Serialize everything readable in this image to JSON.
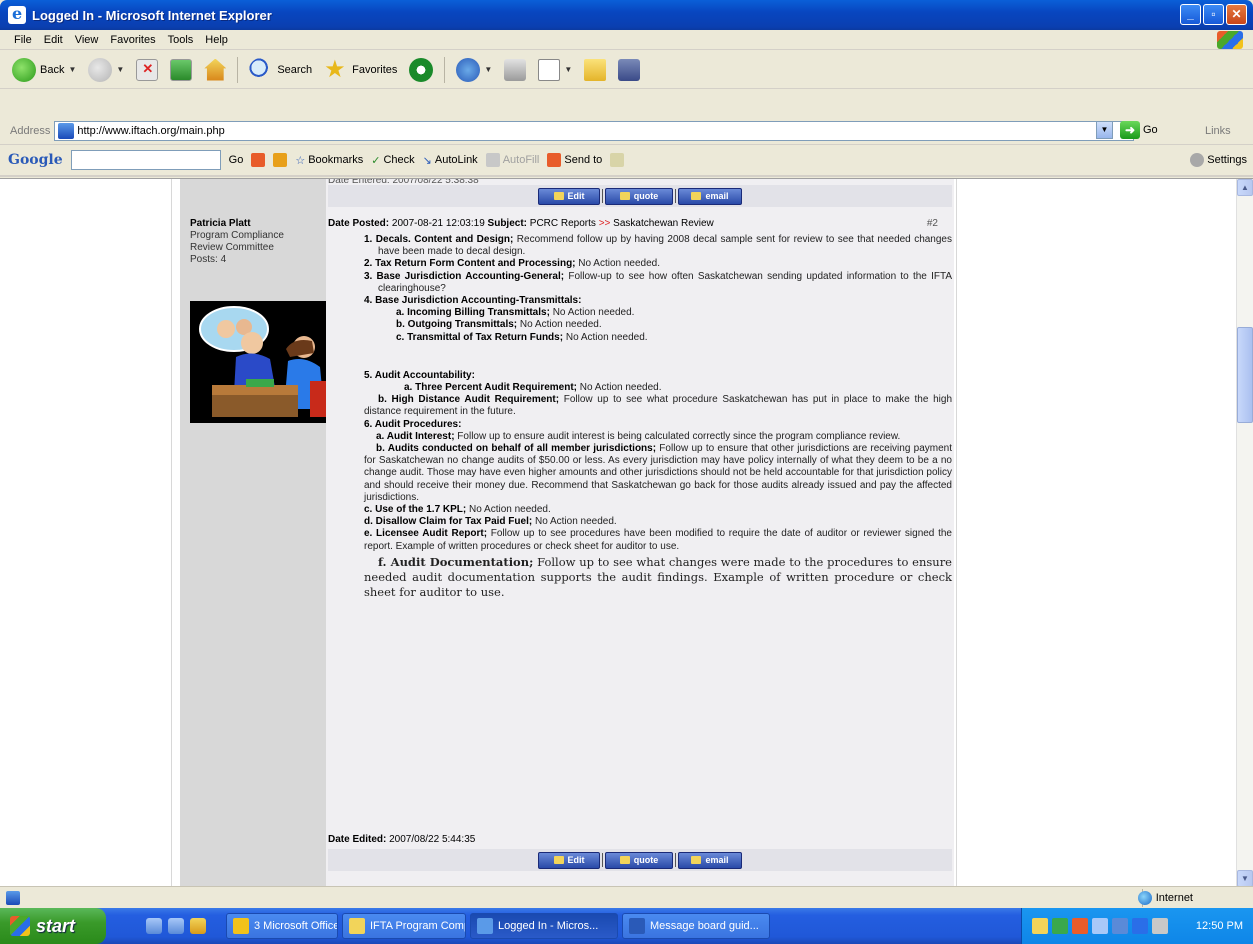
{
  "window": {
    "title": "Logged In - Microsoft Internet Explorer"
  },
  "menu": [
    "File",
    "Edit",
    "View",
    "Favorites",
    "Tools",
    "Help"
  ],
  "toolbar": {
    "back": "Back",
    "search": "Search",
    "favorites": "Favorites"
  },
  "address": {
    "label": "Address",
    "url": "http://www.iftach.org/main.php",
    "go": "Go",
    "links": "Links"
  },
  "google": {
    "logo": "Google",
    "go": "Go",
    "bookmarks": "Bookmarks",
    "check": "Check",
    "autolink": "AutoLink",
    "autofill": "AutoFill",
    "sendto": "Send to",
    "settings": "Settings"
  },
  "post": {
    "date_entered_top": "Date Entered: 2007/08/22 5:38:38",
    "buttons": {
      "edit": "Edit",
      "quote": "quote",
      "email": "email"
    },
    "author": {
      "name": "Patricia Platt",
      "title1": "Program Compliance",
      "title2": "Review Committee",
      "posts": "Posts: 4"
    },
    "posted_label": "Date Posted:",
    "posted_value": "2007-08-21 12:03:19",
    "subject_label": "Subject:",
    "forum": "PCRC Reports",
    "arrow": ">>",
    "topic": "Saskatchewan Review",
    "number": "#2",
    "items": [
      {
        "hd": "1. Decals. Content and Design;",
        "text": " Recommend follow up by having 2008 decal sample sent for review to see that needed changes have been made to decal design."
      },
      {
        "hd": "2. Tax Return Form Content and Processing;",
        "text": " No Action needed."
      },
      {
        "hd": "3. Base Jurisdiction Accounting-General;",
        "text": " Follow-up to see how often Saskatchewan sending updated information to the IFTA clearinghouse?"
      },
      {
        "hd": "4. Base Jurisdiction Accounting-Transmittals:",
        "text": ""
      }
    ],
    "sub4": [
      {
        "hd": "a. Incoming Billing Transmittals;",
        "text": " No Action needed."
      },
      {
        "hd": "b. Outgoing Transmittals;",
        "text": " No Action needed."
      },
      {
        "hd": "c. Transmittal of Tax Return Funds;",
        "text": " No Action needed."
      }
    ],
    "item5": "5. Audit Accountability:",
    "sub5a": {
      "hd": "a. Three Percent Audit Requirement;",
      "text": " No Action needed."
    },
    "sub5b": {
      "hd": "b. High Distance Audit Requirement;",
      "text": " Follow up to see what procedure Saskatchewan has put in place to make the high distance requirement in the future."
    },
    "item6": "6. Audit Procedures:",
    "sub6a": {
      "hd": "a. Audit Interest;",
      "text": " Follow up to ensure audit interest is being calculated correctly since the program compliance review."
    },
    "sub6b": {
      "hd": "b. Audits conducted on behalf of all member jurisdictions;",
      "text": " Follow up to ensure that other jurisdictions are receiving payment for Saskatchewan no change audits of $50.00 or less.  As every jurisdiction may have policy internally of what they deem to be a no change audit. Those may have even higher amounts and other jurisdictions should not be held accountable for that jurisdiction policy and should receive their money due. Recommend that Saskatchewan go back for those audits already issued and pay the affected jurisdictions."
    },
    "sub6c": {
      "hd": "c. Use of the 1.7 KPL;",
      "text": " No Action needed."
    },
    "sub6d": {
      "hd": "d. Disallow Claim for Tax Paid Fuel;",
      "text": " No Action needed."
    },
    "sub6e": {
      "hd": "e. Licensee Audit Report;",
      "text": " Follow up to see procedures have been modified to require the date of auditor or reviewer signed the report. Example of written procedures or check sheet for auditor to use."
    },
    "sub6f": {
      "hd": "f. Audit Documentation;",
      "text": " Follow up to see what changes were made to the procedures to ensure needed audit documentation supports the audit findings. Example of written procedure or check sheet for auditor to use."
    },
    "edited_label": "Date Edited:",
    "edited_value": "2007/08/22 5:44:35"
  },
  "status": {
    "zone": "Internet"
  },
  "taskbar": {
    "start": "start",
    "tasks": [
      "3 Microsoft Office ...",
      "IFTA Program Comp...",
      "Logged In - Micros...",
      "Message board guid..."
    ],
    "clock": "12:50 PM"
  }
}
